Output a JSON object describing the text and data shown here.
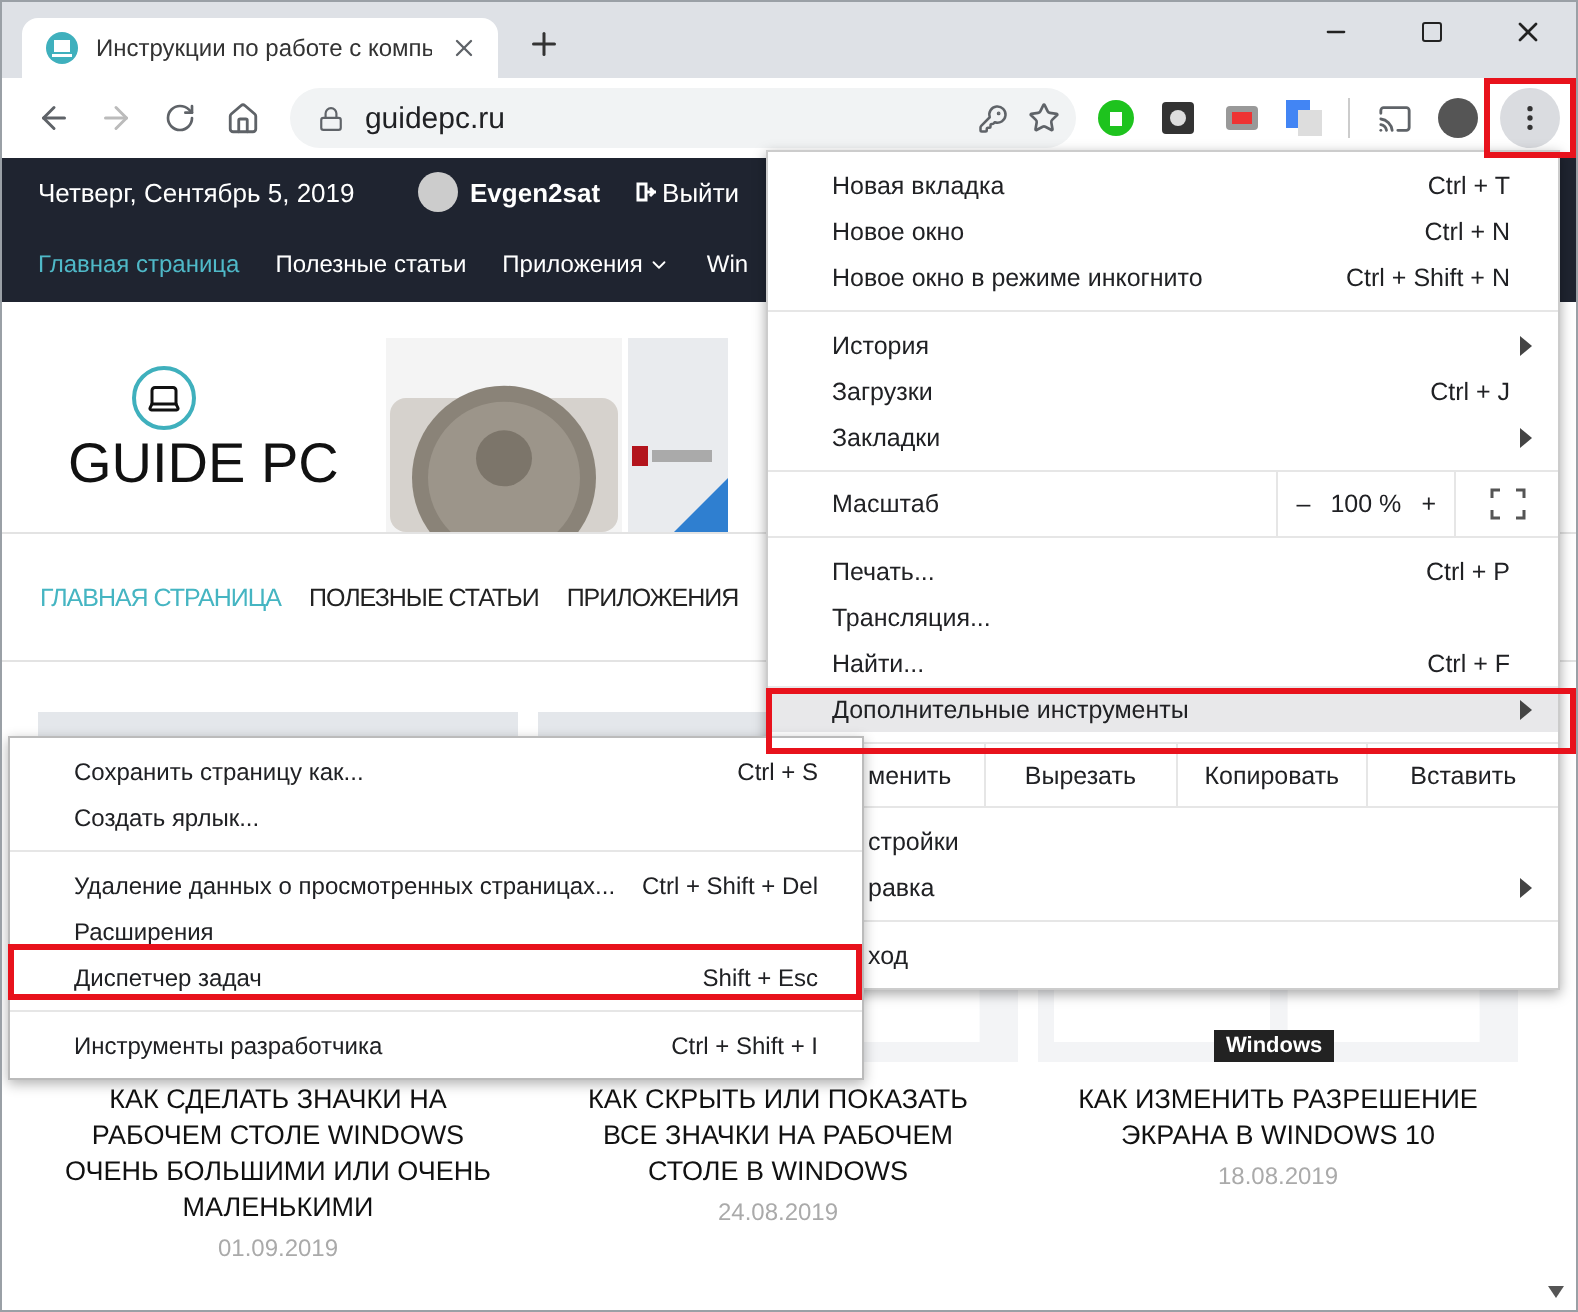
{
  "tab": {
    "title": "Инструкции по работе с компь"
  },
  "toolbar": {
    "url": "guidepc.ru"
  },
  "site": {
    "top_bar": {
      "date": "Четверг, Сентябрь 5, 2019",
      "user": "Evgen2sat",
      "logout": "Выйти"
    },
    "nav": [
      {
        "label": "Главная страница",
        "selected": true,
        "dropdown": false
      },
      {
        "label": "Полезные статьи",
        "selected": false,
        "dropdown": false
      },
      {
        "label": "Приложения",
        "selected": false,
        "dropdown": true
      },
      {
        "label": "Win",
        "selected": false,
        "dropdown": false
      }
    ],
    "logo": "GUIDE PC",
    "menu": [
      {
        "label": "ГЛАВНАЯ СТРАНИЦА",
        "selected": true
      },
      {
        "label": "ПОЛЕЗНЫЕ СТАТЬИ",
        "selected": false
      },
      {
        "label": "ПРИЛОЖЕНИЯ",
        "selected": false
      }
    ],
    "articles": [
      {
        "title": "КАК СДЕЛАТЬ ЗНАЧКИ НА РАБОЧЕМ СТОЛЕ WINDOWS ОЧЕНЬ БОЛЬШИМИ ИЛИ ОЧЕНЬ МАЛЕНЬКИМИ",
        "date": "01.09.2019"
      },
      {
        "title": "КАК СКРЫТЬ ИЛИ ПОКАЗАТЬ ВСЕ ЗНАЧКИ НА РАБОЧЕМ СТОЛЕ В WINDOWS",
        "date": "24.08.2019"
      },
      {
        "title": "КАК ИЗМЕНИТЬ РАЗРЕШЕНИЕ ЭКРАНА В WINDOWS 10",
        "date": "18.08.2019",
        "badge": "Windows"
      }
    ]
  },
  "chrome_menu": {
    "sections": [
      [
        {
          "kind": "item",
          "label": "Новая вкладка",
          "shortcut": "Ctrl + T",
          "submenu": false,
          "selected": false,
          "covered": false
        },
        {
          "kind": "item",
          "label": "Новое окно",
          "shortcut": "Ctrl + N",
          "submenu": false,
          "selected": false,
          "covered": false
        },
        {
          "kind": "item",
          "label": "Новое окно в режиме инкогнито",
          "shortcut": "Ctrl + Shift + N",
          "submenu": false,
          "selected": false,
          "covered": false
        }
      ],
      [
        {
          "kind": "item",
          "label": "История",
          "submenu": true,
          "selected": false,
          "covered": false
        },
        {
          "kind": "item",
          "label": "Загрузки",
          "shortcut": "Ctrl + J",
          "submenu": false,
          "selected": false,
          "covered": false
        },
        {
          "kind": "item",
          "label": "Закладки",
          "submenu": true,
          "selected": false,
          "covered": false
        }
      ],
      [
        {
          "kind": "zoom",
          "label": "Масштаб",
          "minus": "–",
          "value": "100 %",
          "plus": "+"
        }
      ],
      [
        {
          "kind": "item",
          "label": "Печать...",
          "shortcut": "Ctrl + P",
          "submenu": false,
          "selected": false,
          "covered": false
        },
        {
          "kind": "item",
          "label": "Трансляция...",
          "submenu": false,
          "selected": false,
          "covered": false
        },
        {
          "kind": "item",
          "label": "Найти...",
          "shortcut": "Ctrl + F",
          "submenu": false,
          "selected": false,
          "covered": false
        },
        {
          "kind": "item",
          "label": "Дополнительные инструменты",
          "submenu": true,
          "selected": true,
          "covered": false
        }
      ],
      [
        {
          "kind": "edit",
          "buttons": [
            "менить",
            "Вырезать",
            "Копировать",
            "Вставить"
          ]
        }
      ],
      [
        {
          "kind": "item",
          "label": "стройки",
          "submenu": false,
          "selected": false,
          "covered": true
        },
        {
          "kind": "item",
          "label": "равка",
          "submenu": true,
          "selected": false,
          "covered": true
        }
      ],
      [
        {
          "kind": "item",
          "label": "ход",
          "submenu": false,
          "selected": false,
          "covered": true
        }
      ]
    ]
  },
  "submenu": {
    "sections": [
      [
        {
          "label": "Сохранить страницу как...",
          "shortcut": "Ctrl + S",
          "selected": false
        },
        {
          "label": "Создать ярлык...",
          "selected": false
        }
      ],
      [
        {
          "label": "Удаление данных о просмотренных страницах...",
          "shortcut": "Ctrl + Shift + Del",
          "selected": false
        },
        {
          "label": "Расширения",
          "selected": false
        },
        {
          "label": "Диспетчер задач",
          "shortcut": "Shift + Esc",
          "selected": false
        }
      ],
      [
        {
          "label": "Инструменты разработчика",
          "shortcut": "Ctrl + Shift + I",
          "selected": false
        }
      ]
    ]
  }
}
